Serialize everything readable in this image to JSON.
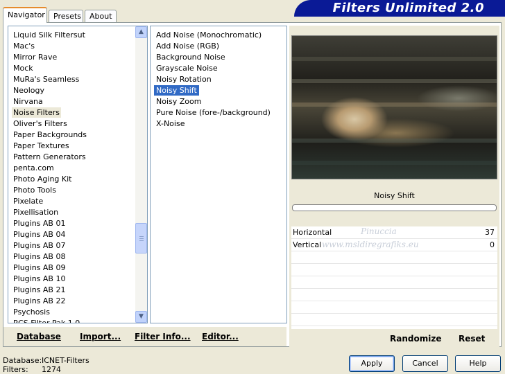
{
  "window": {
    "brand_title": "Filters Unlimited 2.0"
  },
  "tabs": [
    {
      "label": "Navigator"
    },
    {
      "label": "Presets"
    },
    {
      "label": "About"
    }
  ],
  "categories": {
    "items": [
      "Liquid Silk Filtersut",
      "Mac's",
      "Mirror Rave",
      "Mock",
      "MuRa's Seamless",
      "Neology",
      "Nirvana",
      "Noise Filters",
      "Oliver's Filters",
      "Paper Backgrounds",
      "Paper Textures",
      "Pattern Generators",
      "penta.com",
      "Photo Aging Kit",
      "Photo Tools",
      "Pixelate",
      "Pixellisation",
      "Plugins AB 01",
      "Plugins AB 04",
      "Plugins AB 07",
      "Plugins AB 08",
      "Plugins AB 09",
      "Plugins AB 10",
      "Plugins AB 21",
      "Plugins AB 22",
      "Psychosis",
      "RCS Filter Pak 1.0"
    ],
    "selected": "Noise Filters"
  },
  "filters": {
    "items": [
      "Add Noise (Monochromatic)",
      "Add Noise (RGB)",
      "Background Noise",
      "Grayscale Noise",
      "Noisy Rotation",
      "Noisy Shift",
      "Noisy Zoom",
      "Pure Noise (fore-/background)",
      "X-Noise"
    ],
    "selected": "Noisy Shift"
  },
  "left_toolbar": {
    "database": "Database",
    "import": "Import...",
    "filter_info": "Filter Info...",
    "editor": "Editor..."
  },
  "filter_panel": {
    "title": "Noisy Shift",
    "params": [
      {
        "label": "Horizontal",
        "value": "37"
      },
      {
        "label": "Vertical",
        "value": "0"
      }
    ],
    "watermark_top": "Pinuccia",
    "watermark_bottom": "www.msldiregrafiks.eu",
    "randomize": "Randomize",
    "reset": "Reset"
  },
  "footer": {
    "database_label": "Database:",
    "database_value": "ICNET-Filters",
    "filters_label": "Filters:",
    "filters_value": "1274",
    "apply": "Apply",
    "cancel": "Cancel",
    "help": "Help"
  },
  "colors": {
    "brand": "#0a1a96",
    "selection": "#316ac5",
    "dialog_bg": "#ece9d8"
  }
}
